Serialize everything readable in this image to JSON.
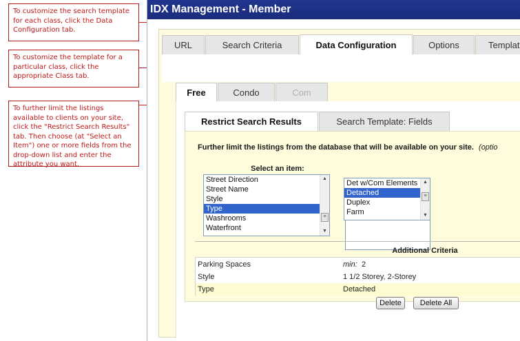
{
  "callouts": [
    "To customize the search template for each class, click the Data Configuration tab.",
    "To customize the template for a particular class, click the appropriate Class tab.",
    "To further limit the listings available to clients on your site, click the \"Restrict Search Results\" tab. Then choose (at \"Select an Item\") one or more fields from the drop-down list and enter the attribute you want."
  ],
  "app": {
    "title": "IDX Management - Member"
  },
  "main_tabs": [
    {
      "label": "URL"
    },
    {
      "label": "Search Criteria"
    },
    {
      "label": "Data Configuration"
    },
    {
      "label": "Options"
    },
    {
      "label": "Templat"
    }
  ],
  "class_tabs": [
    {
      "label": "Free"
    },
    {
      "label": "Condo"
    },
    {
      "label": "Com"
    }
  ],
  "sub_tabs": [
    {
      "label": "Restrict Search Results"
    },
    {
      "label": "Search Template: Fields"
    }
  ],
  "description": {
    "text": "Further limit the listings from the database that will be available on your site.",
    "note": "(optio"
  },
  "select_item": {
    "label": "Select an item:",
    "options": [
      "Street Direction",
      "Street Name",
      "Style",
      "Type",
      "Washrooms",
      "Waterfront"
    ],
    "selected": "Type"
  },
  "value_list": {
    "options": [
      "Det w/Com Elements",
      "Detached",
      "Duplex",
      "Farm"
    ],
    "selected": "Detached"
  },
  "additional_criteria": {
    "title": "Additional Criteria",
    "rows": [
      {
        "field": "Parking Spaces",
        "qualifier": "min:",
        "value": "2"
      },
      {
        "field": "Style",
        "qualifier": "",
        "value": "1 1/2 Storey, 2-Storey"
      },
      {
        "field": "Type",
        "qualifier": "",
        "value": "Detached"
      }
    ]
  },
  "buttons": {
    "delete": "Delete",
    "delete_all": "Delete All"
  },
  "colors": {
    "title_bar": "#1f338a",
    "panel": "#fefcdc",
    "highlight_row": "#fdfbd0",
    "selection": "#3265cc",
    "callout": "#c01818"
  }
}
